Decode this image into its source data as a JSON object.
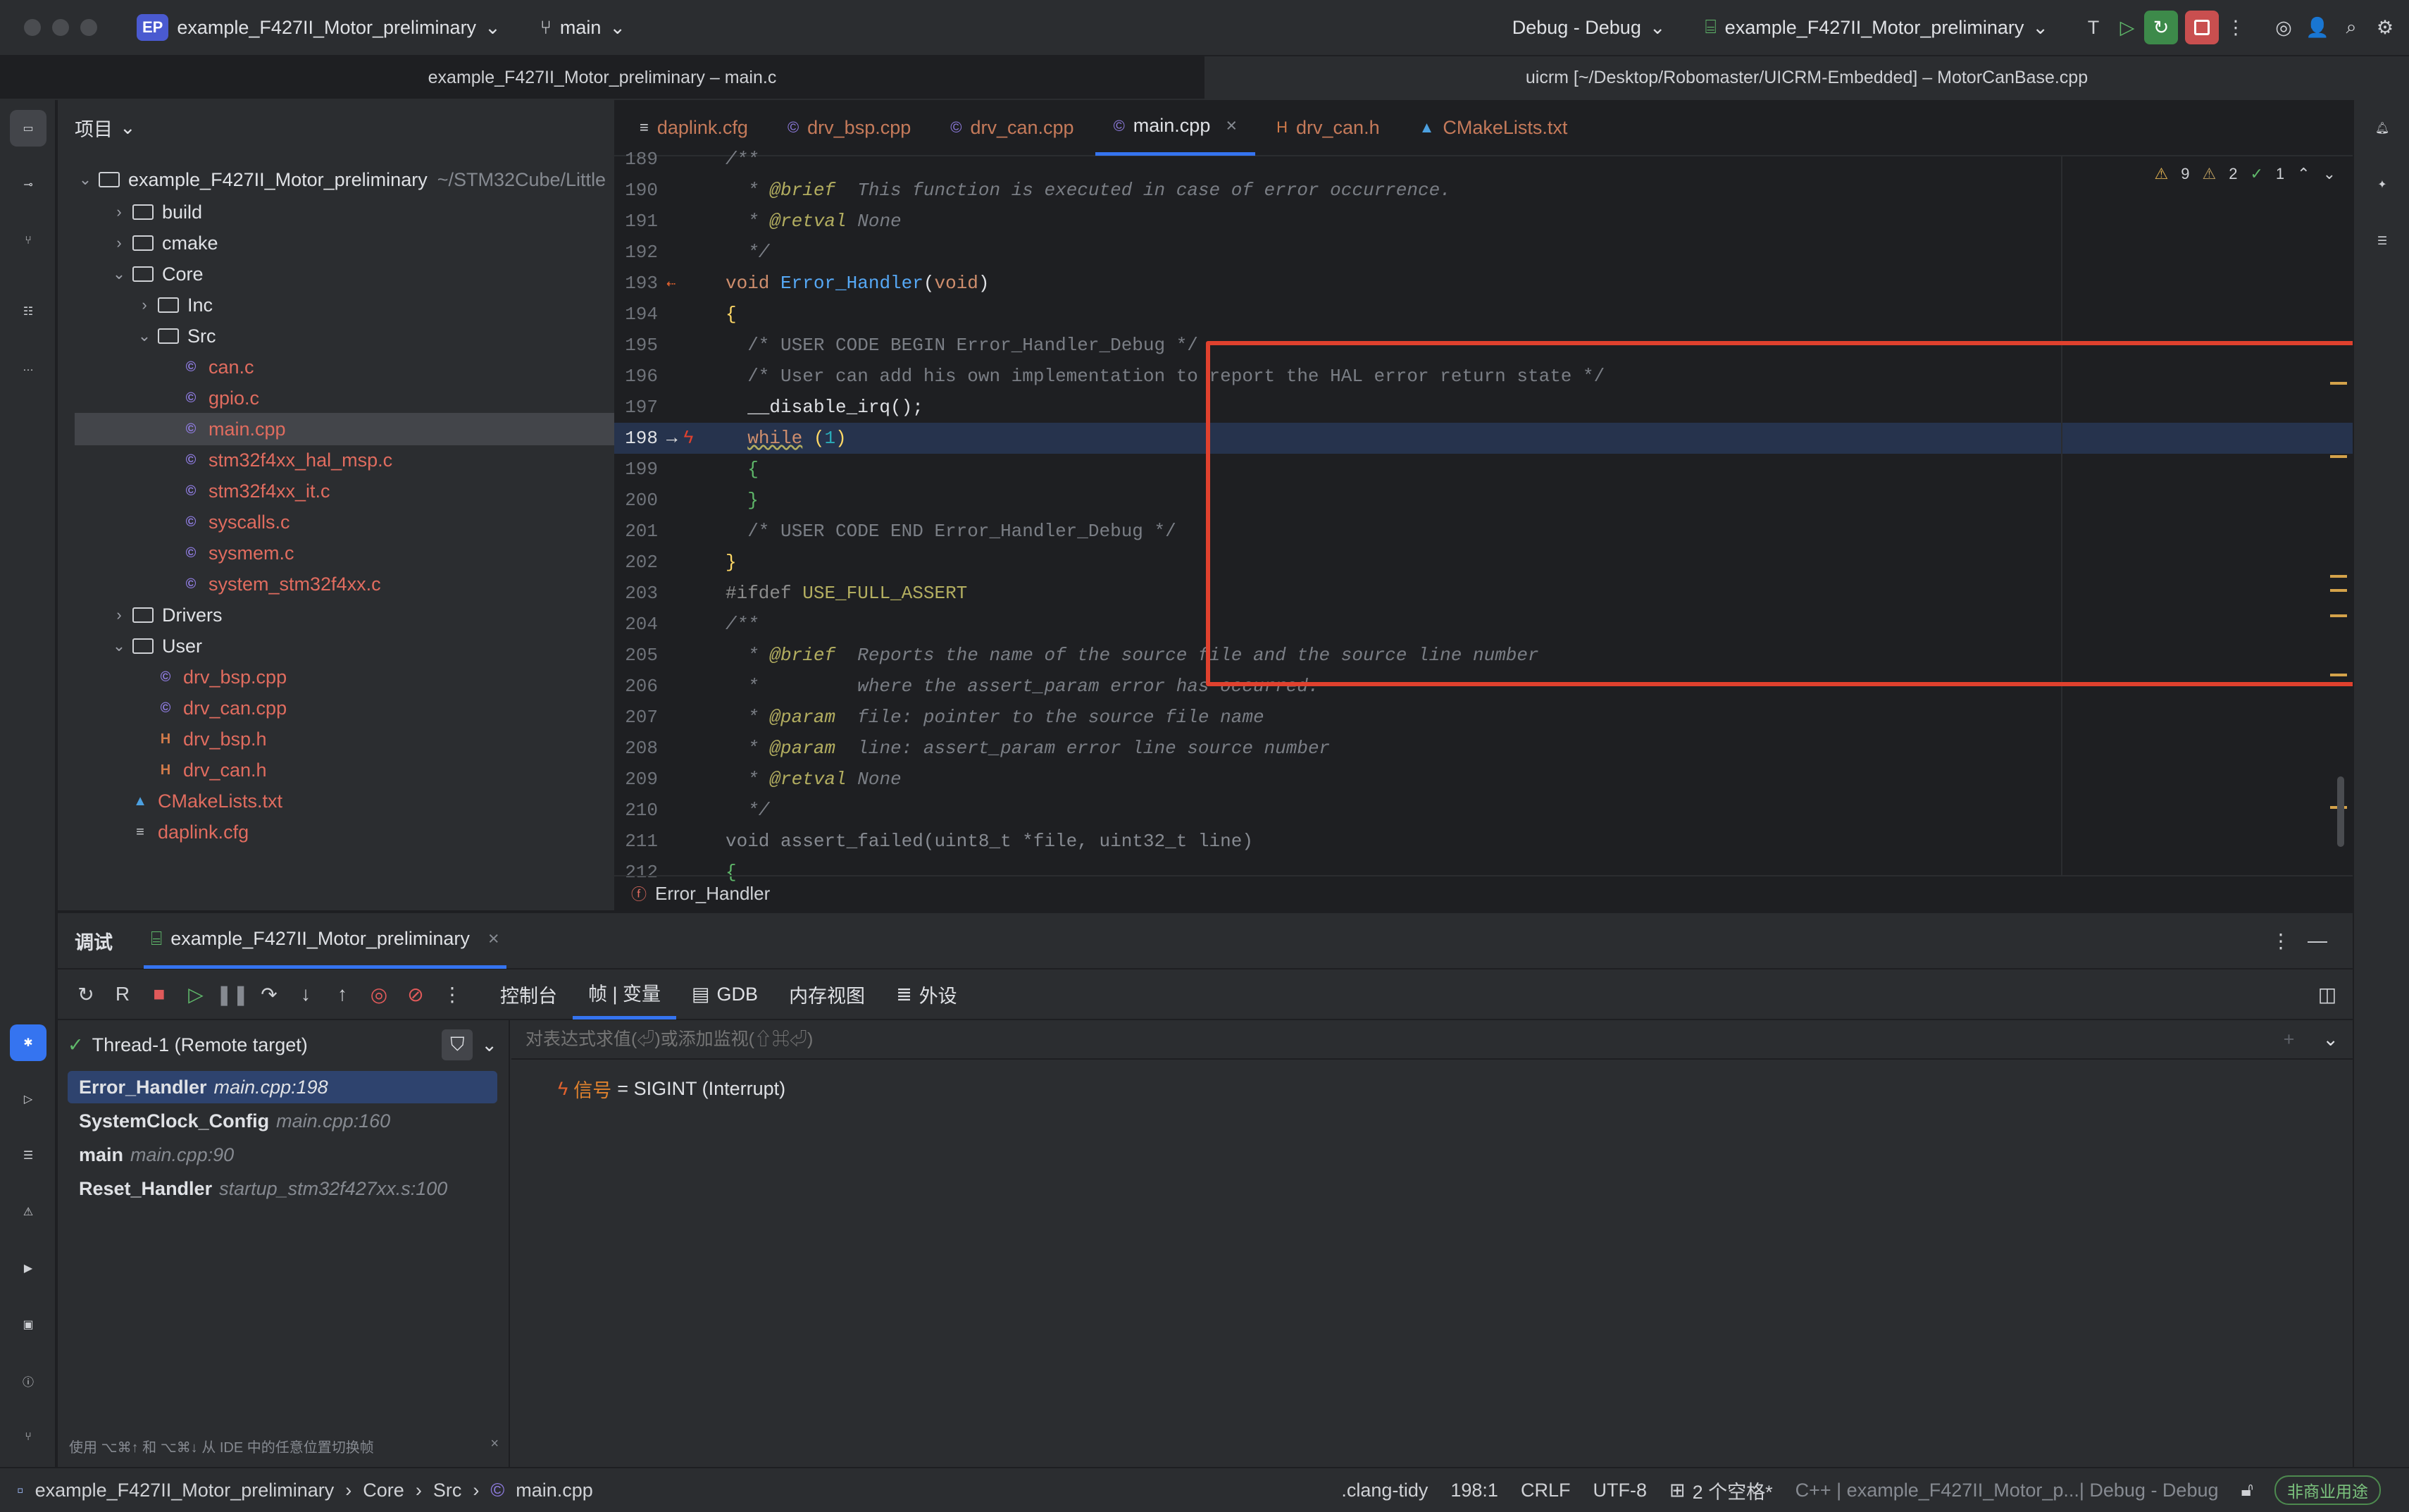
{
  "titlebar": {
    "project_badge": "EP",
    "project_name": "example_F427II_Motor_preliminary",
    "branch": "main",
    "run_config": "Debug - Debug",
    "target": "example_F427II_Motor_preliminary"
  },
  "window_tabs": [
    "example_F427II_Motor_preliminary – main.c",
    "uicrm [~/Desktop/Robomaster/UICRM-Embedded] – MotorCanBase.cpp"
  ],
  "project_panel": {
    "title": "项目",
    "root_name": "example_F427II_Motor_preliminary",
    "root_path": "~/STM32Cube/Little",
    "items": [
      {
        "label": "build",
        "type": "folder",
        "level": 1,
        "expanded": false
      },
      {
        "label": "cmake",
        "type": "folder",
        "level": 1,
        "expanded": false
      },
      {
        "label": "Core",
        "type": "folder",
        "level": 1,
        "expanded": true
      },
      {
        "label": "Inc",
        "type": "folder",
        "level": 2,
        "expanded": false
      },
      {
        "label": "Src",
        "type": "folder",
        "level": 2,
        "expanded": true
      },
      {
        "label": "can.c",
        "type": "c",
        "level": 3
      },
      {
        "label": "gpio.c",
        "type": "c",
        "level": 3
      },
      {
        "label": "main.cpp",
        "type": "c",
        "level": 3,
        "selected": true
      },
      {
        "label": "stm32f4xx_hal_msp.c",
        "type": "c",
        "level": 3
      },
      {
        "label": "stm32f4xx_it.c",
        "type": "c",
        "level": 3
      },
      {
        "label": "syscalls.c",
        "type": "c",
        "level": 3
      },
      {
        "label": "sysmem.c",
        "type": "c",
        "level": 3
      },
      {
        "label": "system_stm32f4xx.c",
        "type": "c",
        "level": 3
      },
      {
        "label": "Drivers",
        "type": "folder",
        "level": 1,
        "expanded": false
      },
      {
        "label": "User",
        "type": "folder",
        "level": 1,
        "expanded": true
      },
      {
        "label": "drv_bsp.cpp",
        "type": "c",
        "level": 2
      },
      {
        "label": "drv_can.cpp",
        "type": "c",
        "level": 2
      },
      {
        "label": "drv_bsp.h",
        "type": "h",
        "level": 2
      },
      {
        "label": "drv_can.h",
        "type": "h",
        "level": 2
      },
      {
        "label": "CMakeLists.txt",
        "type": "cmake",
        "level": 1
      },
      {
        "label": "daplink.cfg",
        "type": "cfg",
        "level": 1
      }
    ]
  },
  "editor": {
    "tabs": [
      {
        "label": "daplink.cfg"
      },
      {
        "label": "drv_bsp.cpp"
      },
      {
        "label": "drv_can.cpp"
      },
      {
        "label": "main.cpp",
        "active": true,
        "close": "×"
      },
      {
        "label": "drv_can.h"
      },
      {
        "label": "CMakeLists.txt"
      }
    ],
    "inspections": {
      "warn1": "9",
      "warn2": "2",
      "ok": "1"
    },
    "breadcrumb": "Error_Handler",
    "lines": [
      {
        "n": "189",
        "t": "/**"
      },
      {
        "n": "190",
        "t": "  * @brief  This function is executed in case of error occurrence."
      },
      {
        "n": "191",
        "t": "  * @retval None"
      },
      {
        "n": "192",
        "t": "  */"
      },
      {
        "n": "193",
        "t": "void Error_Handler(void)"
      },
      {
        "n": "194",
        "t": "{"
      },
      {
        "n": "195",
        "t": "  /* USER CODE BEGIN Error_Handler_Debug */"
      },
      {
        "n": "196",
        "t": "  /* User can add his own implementation to report the HAL error return state */"
      },
      {
        "n": "197",
        "t": "  __disable_irq();"
      },
      {
        "n": "198",
        "t": "  while (1)"
      },
      {
        "n": "199",
        "t": "  {"
      },
      {
        "n": "200",
        "t": "  }"
      },
      {
        "n": "201",
        "t": "  /* USER CODE END Error_Handler_Debug */"
      },
      {
        "n": "202",
        "t": "}"
      },
      {
        "n": "203",
        "t": "#ifdef USE_FULL_ASSERT"
      },
      {
        "n": "204",
        "t": "/**"
      },
      {
        "n": "205",
        "t": "  * @brief  Reports the name of the source file and the source line number"
      },
      {
        "n": "206",
        "t": "  *         where the assert_param error has occurred."
      },
      {
        "n": "207",
        "t": "  * @param  file: pointer to the source file name"
      },
      {
        "n": "208",
        "t": "  * @param  line: assert_param error line source number"
      },
      {
        "n": "209",
        "t": "  * @retval None"
      },
      {
        "n": "210",
        "t": "  */"
      },
      {
        "n": "211",
        "t": "void assert_failed(uint8_t *file, uint32_t line)"
      },
      {
        "n": "212",
        "t": "{"
      }
    ]
  },
  "debug": {
    "title": "调试",
    "session": "example_F427II_Motor_preliminary",
    "tabs": [
      "控制台",
      "帧 | 变量",
      "GDB",
      "内存视图",
      "外设"
    ],
    "thread": "Thread-1 (Remote target)",
    "frames": [
      {
        "fn": "Error_Handler",
        "loc": "main.cpp:198"
      },
      {
        "fn": "SystemClock_Config",
        "loc": "main.cpp:160"
      },
      {
        "fn": "main",
        "loc": "main.cpp:90"
      },
      {
        "fn": "Reset_Handler",
        "loc": "startup_stm32f427xx.s:100"
      }
    ],
    "eval_placeholder": "对表达式求值(⏎)或添加监视(⇧⌘⏎)",
    "signal_label": "信号",
    "signal_value": " = SIGINT (Interrupt)",
    "hint": "使用 ⌥⌘↑ 和 ⌥⌘↓ 从 IDE 中的任意位置切换帧"
  },
  "statusbar": {
    "path": [
      "example_F427II_Motor_preliminary",
      "Core",
      "Src",
      "main.cpp"
    ],
    "clang_tidy": ".clang-tidy",
    "position": "198:1",
    "line_ending": "CRLF",
    "encoding": "UTF-8",
    "indent": "2 个空格*",
    "context": "C++ | example_F427II_Motor_p...| Debug - Debug",
    "license": "非商业用途"
  }
}
